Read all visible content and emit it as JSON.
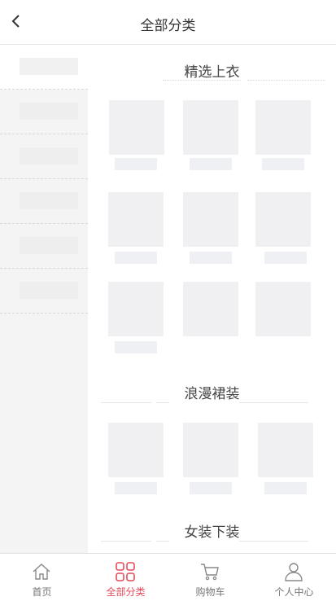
{
  "header": {
    "title": "全部分类",
    "back_icon": "chevron-left-icon"
  },
  "sidebar": {
    "items": 6,
    "active_index": 0
  },
  "sections": [
    {
      "title": "精选上衣"
    },
    {
      "title": "浪漫裙装"
    },
    {
      "title": "女装下装"
    }
  ],
  "tabbar": {
    "items": [
      {
        "label": "首页",
        "icon": "home-icon"
      },
      {
        "label": "全部分类",
        "icon": "category-grid-icon"
      },
      {
        "label": "购物车",
        "icon": "cart-icon"
      },
      {
        "label": "个人中心",
        "icon": "user-icon"
      }
    ],
    "active_index": 1,
    "accent_color": "#e64a5a",
    "inactive_color": "#888888"
  }
}
